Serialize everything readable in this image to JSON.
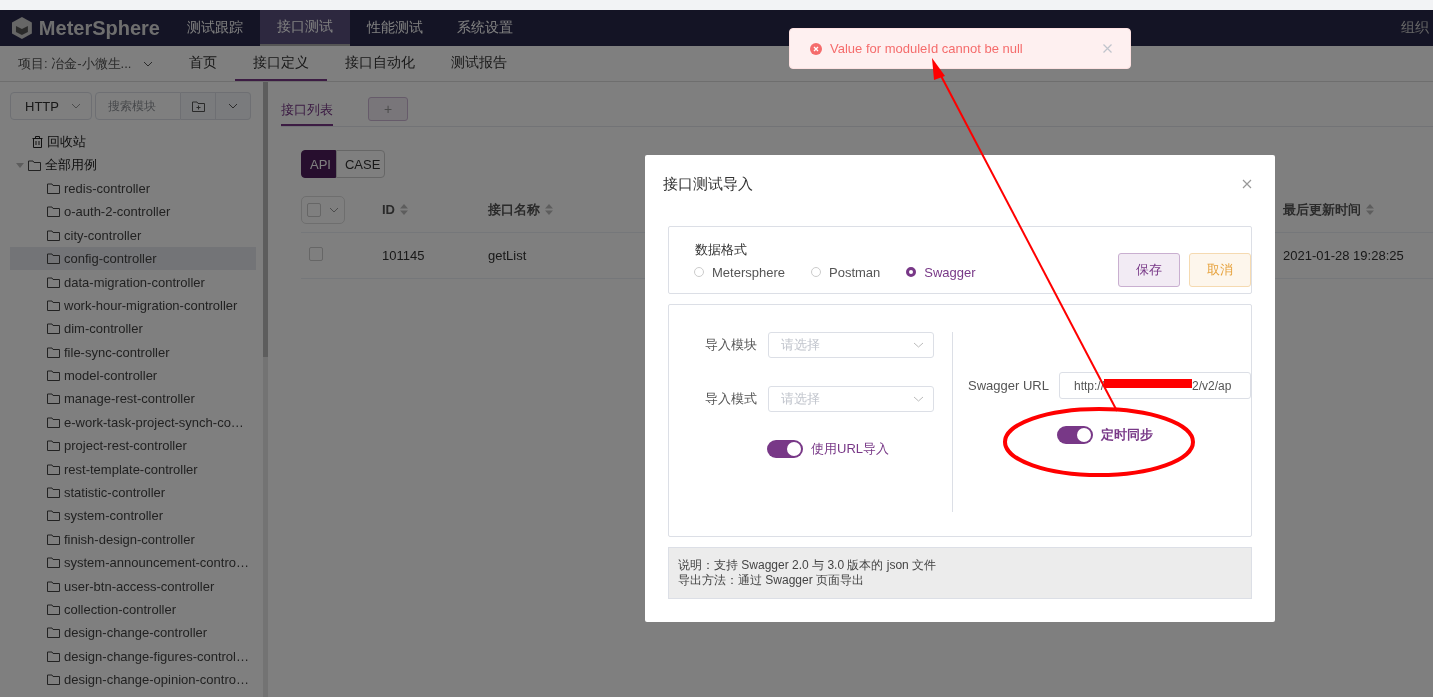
{
  "top_nav": {
    "logo": "MeterSphere",
    "tabs": [
      {
        "label": "测试跟踪",
        "selected": false
      },
      {
        "label": "接口测试",
        "selected": true
      },
      {
        "label": "性能测试",
        "selected": false
      },
      {
        "label": "系统设置",
        "selected": false
      }
    ],
    "org": "组织"
  },
  "sub_nav": {
    "project": "项目: 冶金-小微生...",
    "tabs": [
      {
        "label": "首页",
        "selected": false
      },
      {
        "label": "接口定义",
        "selected": true
      },
      {
        "label": "接口自动化",
        "selected": false
      },
      {
        "label": "测试报告",
        "selected": false
      }
    ]
  },
  "sidebar": {
    "protocol": "HTTP",
    "search": {
      "placeholder": "搜索模块"
    },
    "trash": "回收站",
    "root": {
      "label": "全部用例",
      "expanded": true,
      "children": [
        {
          "label": "redis-controller",
          "selected": false
        },
        {
          "label": "o-auth-2-controller",
          "selected": false
        },
        {
          "label": "city-controller",
          "selected": false
        },
        {
          "label": "config-controller",
          "selected": true
        },
        {
          "label": "data-migration-controller",
          "selected": false
        },
        {
          "label": "work-hour-migration-controller",
          "selected": false
        },
        {
          "label": "dim-controller",
          "selected": false
        },
        {
          "label": "file-sync-controller",
          "selected": false
        },
        {
          "label": "model-controller",
          "selected": false
        },
        {
          "label": "manage-rest-controller",
          "selected": false
        },
        {
          "label": "e-work-task-project-synch-co…",
          "selected": false
        },
        {
          "label": "project-rest-controller",
          "selected": false
        },
        {
          "label": "rest-template-controller",
          "selected": false
        },
        {
          "label": "statistic-controller",
          "selected": false
        },
        {
          "label": "system-controller",
          "selected": false
        },
        {
          "label": "finish-design-controller",
          "selected": false
        },
        {
          "label": "system-announcement-contro…",
          "selected": false
        },
        {
          "label": "user-btn-access-controller",
          "selected": false
        },
        {
          "label": "collection-controller",
          "selected": false
        },
        {
          "label": "design-change-controller",
          "selected": false
        },
        {
          "label": "design-change-figures-control…",
          "selected": false
        },
        {
          "label": "design-change-opinion-contro…",
          "selected": false
        }
      ]
    }
  },
  "content": {
    "tabs": [
      {
        "label": "接口列表",
        "selected": true
      }
    ],
    "add_label": "+",
    "modes": [
      {
        "label": "API",
        "selected": true
      },
      {
        "label": "CASE",
        "selected": false
      }
    ],
    "table": {
      "columns": [
        "ID",
        "接口名称",
        "最后更新时间"
      ],
      "rows": [
        {
          "checked": false,
          "cells": [
            "101145",
            "getList",
            "2021-01-28 19:28:25"
          ]
        }
      ]
    }
  },
  "dialog": {
    "title": "接口测试导入",
    "format_label": "数据格式",
    "formats": [
      {
        "label": "Metersphere",
        "selected": false
      },
      {
        "label": "Postman",
        "selected": false
      },
      {
        "label": "Swagger",
        "selected": true
      }
    ],
    "buttons": [
      {
        "label": "保存",
        "kind": "primary"
      },
      {
        "label": "取消",
        "kind": "warning"
      }
    ],
    "module": {
      "label": "导入模块",
      "placeholder": "请选择"
    },
    "mode": {
      "label": "导入模式",
      "placeholder": "请选择"
    },
    "url_switch": {
      "label": "使用URL导入",
      "on": true
    },
    "url": {
      "label": "Swagger URL",
      "value_start": "http://",
      "value_end": "2/v2/ap"
    },
    "sync_switch": {
      "label": "定时同步",
      "on": true
    },
    "notes": [
      "说明：支持 Swagger 2.0 与 3.0 版本的 json 文件",
      "导出方法：通过 Swagger 页面导出"
    ]
  },
  "toast": {
    "kind": "error",
    "message": "Value for moduleId cannot be null"
  }
}
